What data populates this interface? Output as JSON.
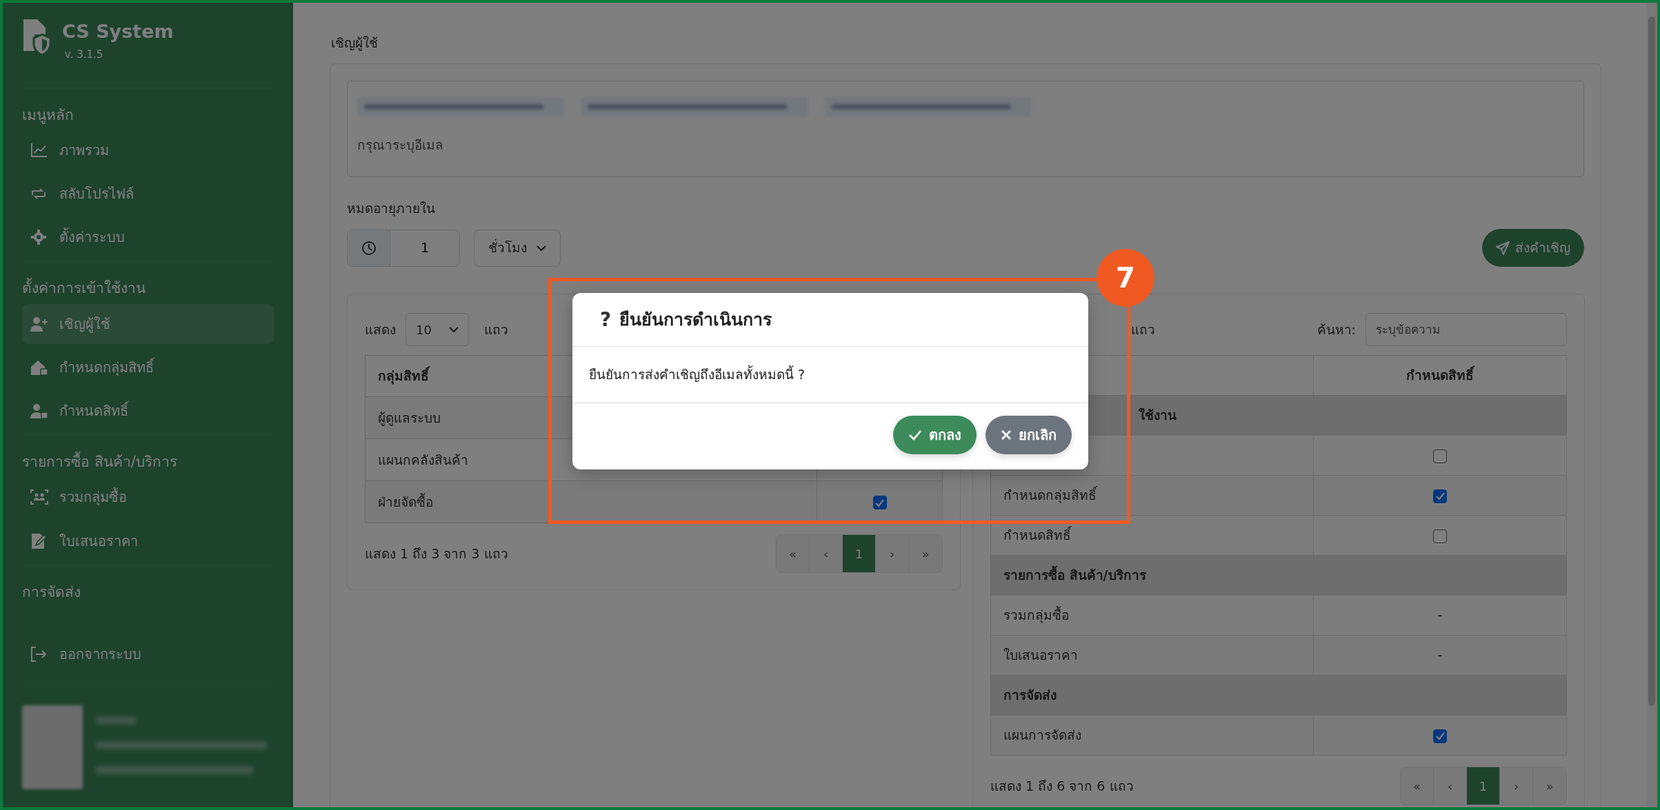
{
  "sidebar": {
    "app_name": "CS System",
    "version": "v. 3.1.5",
    "sections": [
      {
        "title": "เมนูหลัก",
        "items": [
          {
            "label": "ภาพรวม",
            "selected": false
          },
          {
            "label": "สลับโปรไฟล์",
            "selected": false
          },
          {
            "label": "ตั้งค่าระบบ",
            "selected": false
          }
        ]
      },
      {
        "title": "ตั้งค่าการเข้าใช้งาน",
        "items": [
          {
            "label": "เชิญผู้ใช้",
            "selected": true
          },
          {
            "label": "กำหนดกลุ่มสิทธิ์",
            "selected": false
          },
          {
            "label": "กำหนดสิทธิ์",
            "selected": false
          }
        ]
      },
      {
        "title": "รายการซื้อ สินค้า/บริการ",
        "items": [
          {
            "label": "รวมกลุ่มซื้อ",
            "selected": false
          },
          {
            "label": "ใบเสนอราคา",
            "selected": false
          }
        ]
      },
      {
        "title": "การจัดส่ง"
      }
    ],
    "logout": "ออกจากระบบ"
  },
  "page_title": "เชิญผู้ใช้",
  "email_field": {
    "placeholder": "กรุณาระบุอีเมล"
  },
  "expiry": {
    "label": "หมดอายุภายใน",
    "value": "1",
    "unit": "ชั่วโมง"
  },
  "send_button": "ส่งคำเชิญ",
  "groups_table": {
    "length_prefix": "แสดง",
    "length_value": "10",
    "length_suffix": "แถว",
    "columns": [
      "กลุ่มสิทธิ์"
    ],
    "rows": [
      {
        "name": "ผู้ดูแลระบบ"
      },
      {
        "name": "แผนกคลังสินค้า"
      },
      {
        "name": "ฝ่ายจัดซื้อ",
        "checked": true
      }
    ],
    "info": "แสดง 1 ถึง 3 จาก 3 แถว",
    "pager": [
      {
        "label": "«",
        "selected": false
      },
      {
        "label": "‹",
        "selected": false
      },
      {
        "label": "1",
        "selected": true
      },
      {
        "label": "›",
        "selected": false
      },
      {
        "label": "»",
        "selected": false
      }
    ]
  },
  "permissions_table": {
    "length_suffix": "แถว",
    "search_label": "ค้นหา:",
    "search_placeholder": "ระบุข้อความ",
    "column_2": "กำหนดสิทธิ์",
    "rows": [
      {
        "kind": "section",
        "label": "ใช้งาน"
      },
      {
        "kind": "item",
        "checked": false
      },
      {
        "kind": "item",
        "label": "กำหนดกลุ่มสิทธิ์",
        "checked": true
      },
      {
        "kind": "item",
        "label": "กำหนดสิทธิ์",
        "checked": false
      },
      {
        "kind": "section",
        "label": "รายการซื้อ สินค้า/บริการ"
      },
      {
        "kind": "item",
        "label": "รวมกลุ่มซื้อ",
        "value": "-"
      },
      {
        "kind": "item",
        "label": "ใบเสนอราคา",
        "value": "-"
      },
      {
        "kind": "section",
        "label": "การจัดส่ง"
      },
      {
        "kind": "item",
        "label": "แผนการจัดส่ง",
        "checked": true
      }
    ],
    "info": "แสดง 1 ถึง 6 จาก 6 แถว",
    "pager": [
      {
        "label": "«",
        "selected": false
      },
      {
        "label": "‹",
        "selected": false
      },
      {
        "label": "1",
        "selected": true
      },
      {
        "label": "›",
        "selected": false
      },
      {
        "label": "»",
        "selected": false
      }
    ]
  },
  "modal": {
    "title_icon": "?",
    "title": "ยืนยันการดำเนินการ",
    "message": "ยืนยันการส่งคำเชิญถึงอีเมลทั้งหมดนี้ ?",
    "buttons": [
      {
        "kind": "confirm",
        "label": "ตกลง"
      },
      {
        "kind": "cancel",
        "label": "ยกเลิก"
      }
    ]
  },
  "annotation": {
    "step": "7"
  }
}
